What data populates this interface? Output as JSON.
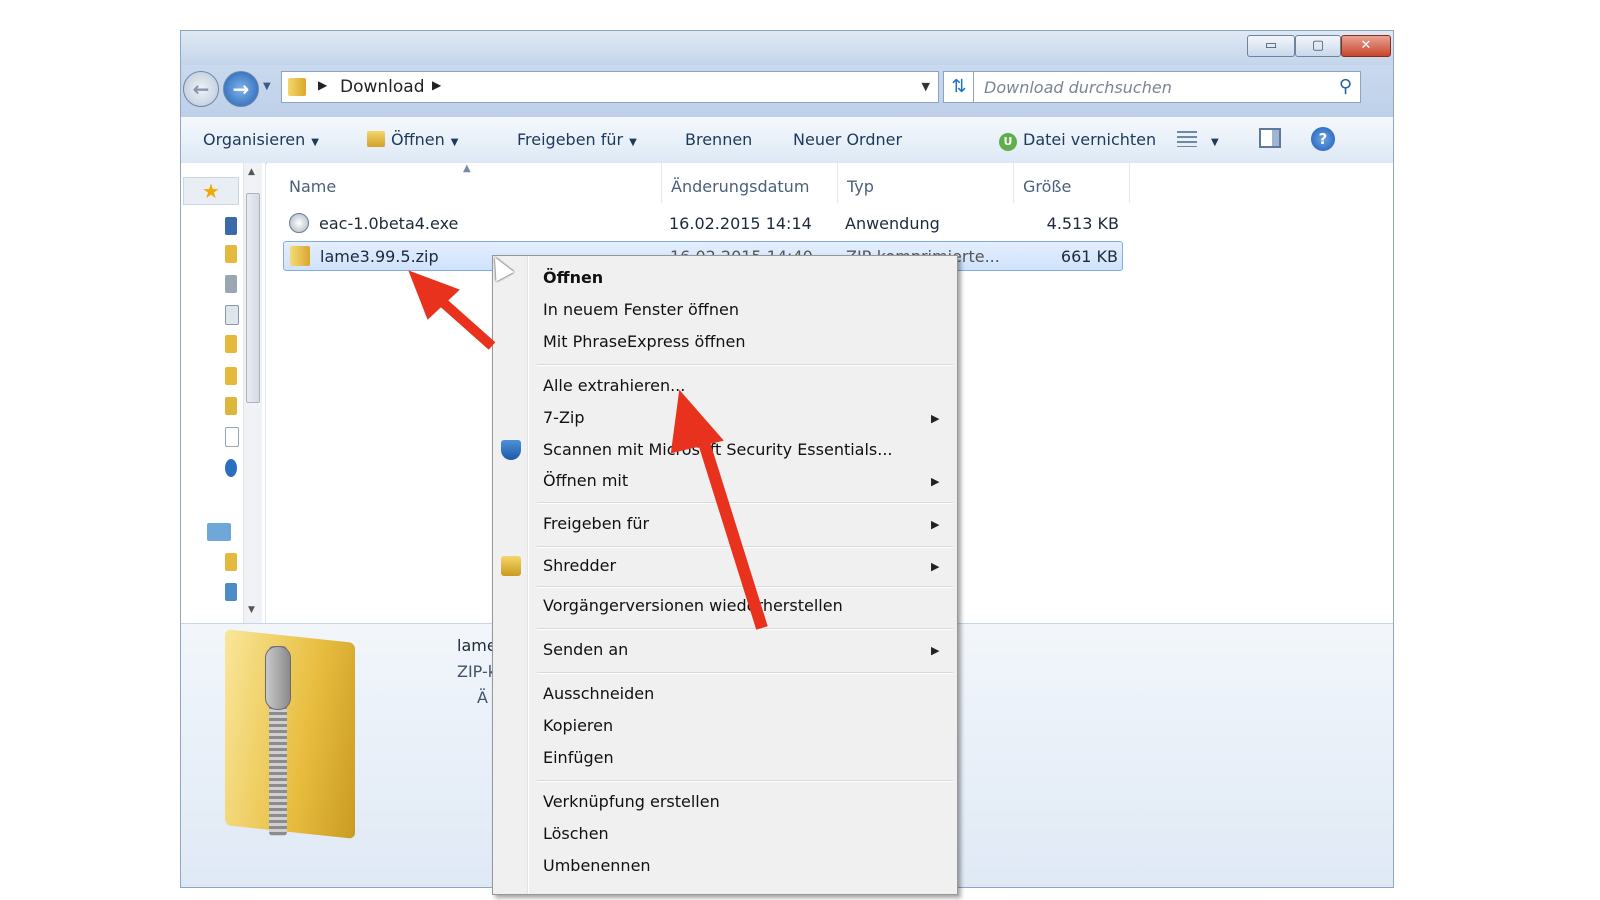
{
  "window": {
    "controls": {
      "minimize": "▭",
      "maximize": "▢",
      "close": "✕"
    }
  },
  "address": {
    "crumb": "Download",
    "search_placeholder": "Download durchsuchen"
  },
  "toolbar": {
    "organize": "Organisieren",
    "open": "Öffnen",
    "share": "Freigeben für",
    "burn": "Brennen",
    "new_folder": "Neuer Ordner",
    "shred": "Datei vernichten"
  },
  "columns": [
    "Name",
    "Änderungsdatum",
    "Typ",
    "Größe"
  ],
  "files": [
    {
      "name": "eac-1.0beta4.exe",
      "date": "16.02.2015 14:14",
      "type": "Anwendung",
      "size": "4.513 KB",
      "icon": "exe-icon",
      "selected": false
    },
    {
      "name": "lame3.99.5.zip",
      "date": "16.02.2015 14:40",
      "type": "ZIP-komprimierte...",
      "size": "661 KB",
      "icon": "zip-icon",
      "selected": true
    }
  ],
  "details": {
    "name": "lame",
    "type": "ZIP-k",
    "date_label": "Ä"
  },
  "context_menu": {
    "items": [
      "Öffnen",
      "In neuem Fenster öffnen",
      "Mit PhraseExpress öffnen",
      "Alle extrahieren...",
      "7-Zip",
      "Scannen mit Microsoft Security Essentials...",
      "Öffnen mit",
      "Freigeben für",
      "Shredder",
      "Vorgängerversionen wiederherstellen",
      "Senden an",
      "Ausschneiden",
      "Kopieren",
      "Einfügen",
      "Verknüpfung erstellen",
      "Löschen",
      "Umbenennen"
    ]
  },
  "colors": {
    "annotation_arrow": "#e8321e",
    "selection": "#cfe2fc",
    "accent": "#1e395b"
  }
}
